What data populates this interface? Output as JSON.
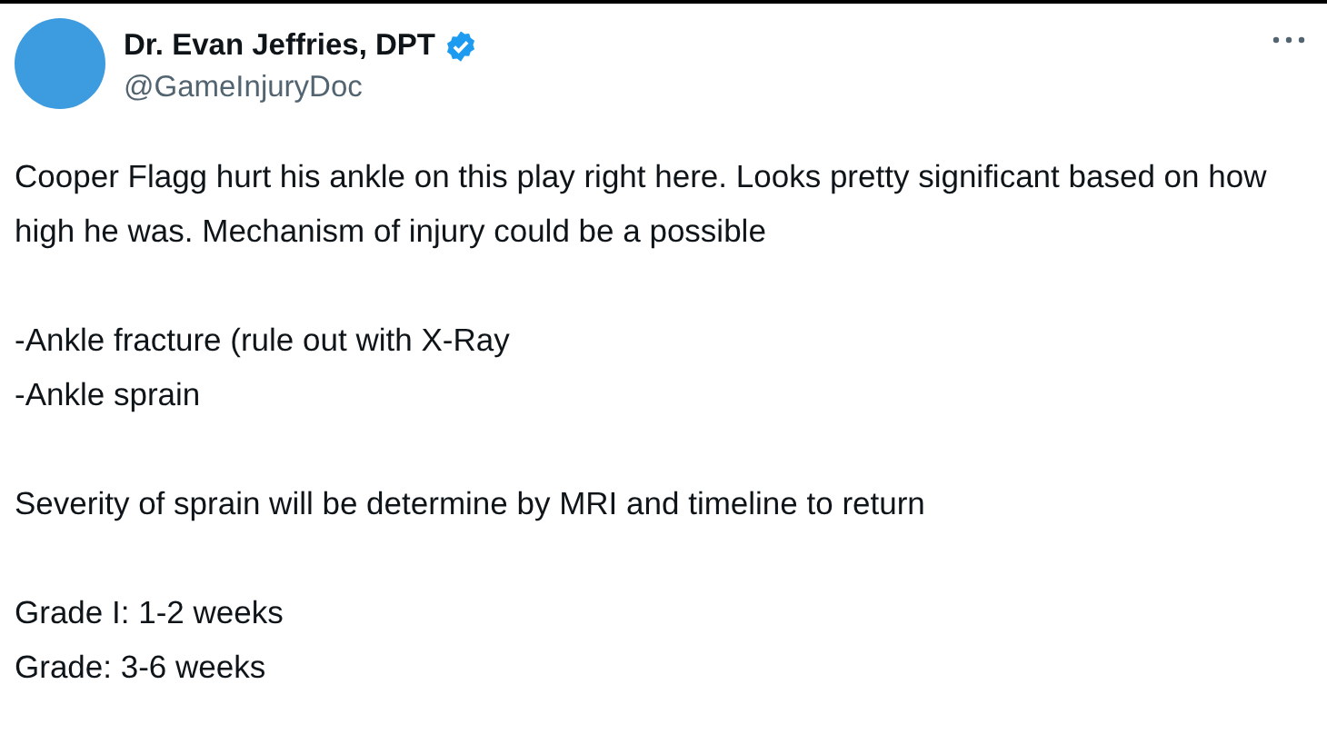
{
  "author": {
    "name": "Dr. Evan Jeffries, DPT",
    "verified": true,
    "handle": "@GameInjuryDoc"
  },
  "blocks": [
    {
      "lines": [
        "Cooper Flagg hurt his ankle on this play right here. Looks pretty significant based on how high he was. Mechanism of injury could be a possible"
      ]
    },
    {
      "lines": [
        "-Ankle fracture (rule out with X-Ray",
        "-Ankle sprain"
      ]
    },
    {
      "lines": [
        "Severity of sprain will be determine by MRI and timeline to return"
      ]
    },
    {
      "lines": [
        "Grade I: 1-2 weeks",
        "Grade: 3-6 weeks"
      ]
    }
  ]
}
